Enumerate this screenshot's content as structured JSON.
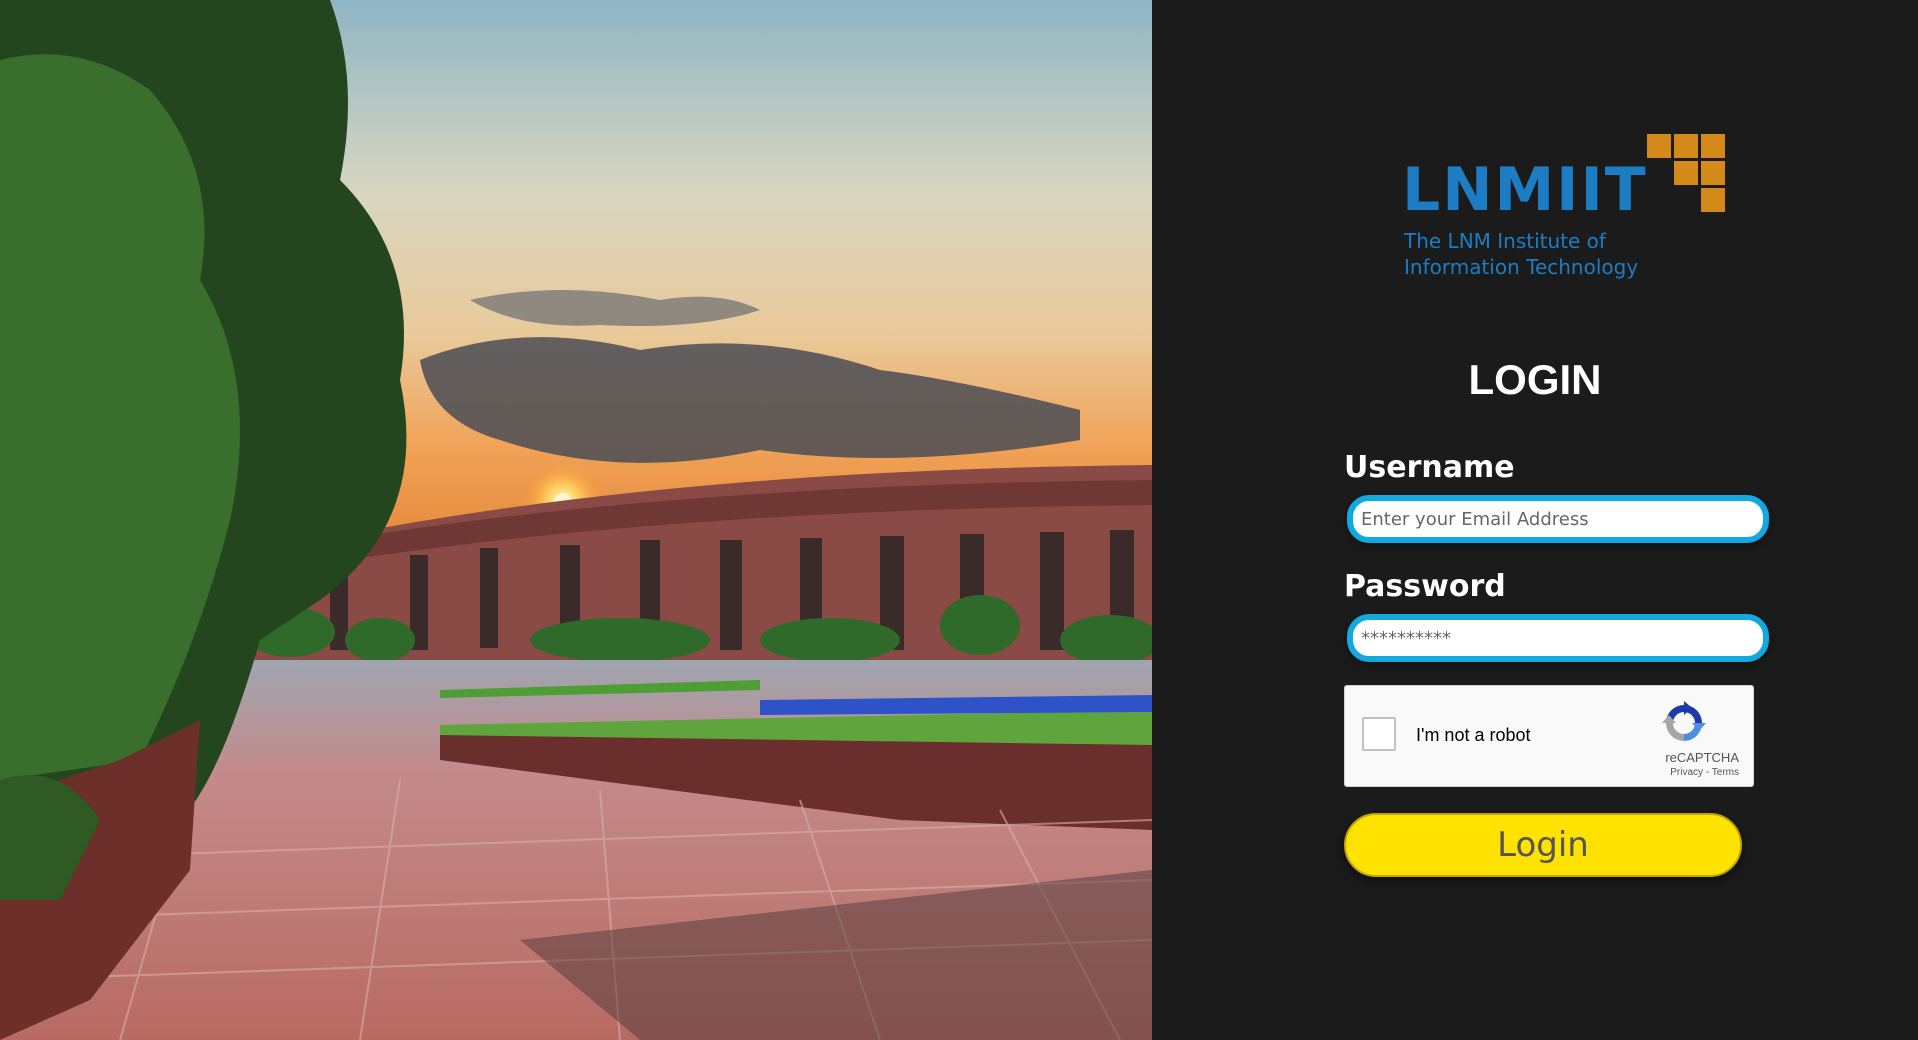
{
  "logo": {
    "name": "LNMIIT",
    "tagline_line1": "The LNM Institute of",
    "tagline_line2": "Information Technology"
  },
  "form": {
    "title": "LOGIN",
    "username_label": "Username",
    "username_placeholder": "Enter your Email Address",
    "password_label": "Password",
    "password_placeholder": "**********",
    "login_button": "Login"
  },
  "captcha": {
    "label": "I'm not a robot",
    "brand": "reCAPTCHA",
    "privacy": "Privacy",
    "separator": " - ",
    "terms": "Terms"
  },
  "colors": {
    "panel_bg": "#1b1b1b",
    "input_border": "#12a9e0",
    "button_bg": "#ffe200",
    "logo_blue": "#1d7dc4",
    "logo_orange": "#d48a1a"
  }
}
